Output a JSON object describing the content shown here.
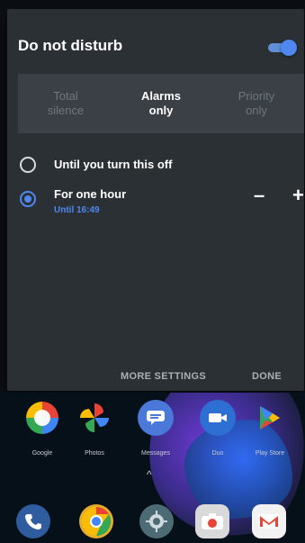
{
  "dnd": {
    "title": "Do not disturb",
    "toggle_on": true,
    "modes": [
      {
        "line1": "Total",
        "line2": "silence",
        "selected": false
      },
      {
        "line1": "Alarms",
        "line2": "only",
        "selected": true
      },
      {
        "line1": "Priority",
        "line2": "only",
        "selected": false
      }
    ],
    "options": {
      "until_off": {
        "label": "Until you turn this off",
        "selected": false
      },
      "one_hour": {
        "label": "For one hour",
        "sub": "Until 16:49",
        "selected": true
      }
    },
    "stepper": {
      "minus": "–",
      "plus": "+"
    },
    "buttons": {
      "more_settings": "MORE SETTINGS",
      "done": "DONE"
    }
  },
  "home": {
    "apps": [
      {
        "name": "Google"
      },
      {
        "name": "Photos"
      },
      {
        "name": "Messages"
      },
      {
        "name": "Duo"
      },
      {
        "name": "Play Store"
      }
    ],
    "caret": "^"
  },
  "colors": {
    "panel": "#2b3034",
    "segment_bg": "#3a4045",
    "accent": "#4f87f0"
  }
}
